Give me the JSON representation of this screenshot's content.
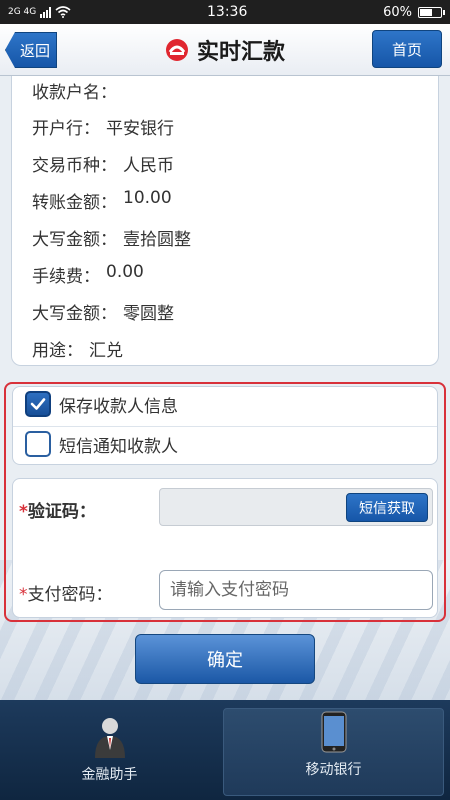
{
  "status_bar": {
    "network": "2G 4G",
    "time": "13:36",
    "battery": "60%",
    "battery_level": 0.6
  },
  "header": {
    "back_label": "返回",
    "title": "实时汇款",
    "home_label": "首页",
    "logo_icon": "bank-logo-icon"
  },
  "info": {
    "rows": [
      {
        "label": "收款户名：",
        "value": ""
      },
      {
        "label": "开户行：",
        "value": "平安银行"
      },
      {
        "label": "交易币种：",
        "value": "人民币"
      },
      {
        "label": "转账金额：",
        "value": "10.00"
      },
      {
        "label": "大写金额：",
        "value": "壹拾圆整"
      },
      {
        "label": "手续费：",
        "value": "0.00"
      },
      {
        "label": "大写金额：",
        "value": "零圆整"
      },
      {
        "label": "用途：",
        "value": "汇兑"
      }
    ]
  },
  "options": {
    "save_payee": {
      "label": "保存收款人信息",
      "checked": true
    },
    "sms_notify": {
      "label": "短信通知收款人",
      "checked": false
    }
  },
  "verify": {
    "code_label": "验证码：",
    "sms_button": "短信获取",
    "pwd_label": "支付密码：",
    "pwd_placeholder": "请输入支付密码",
    "required_mark": "*"
  },
  "confirm_label": "确定",
  "bottom_nav": {
    "items": [
      {
        "label": "金融助手",
        "icon": "assistant-person-icon"
      },
      {
        "label": "移动银行",
        "icon": "mobile-phone-icon"
      }
    ]
  },
  "colors": {
    "accent": "#1656a8",
    "highlight_border": "#d8313a",
    "nav_bg": "#1d3a5c"
  }
}
